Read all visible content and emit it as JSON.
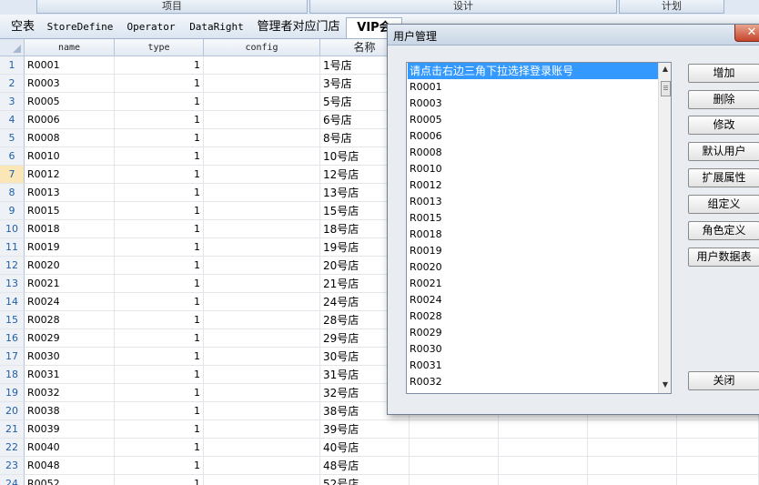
{
  "topbar": {
    "buttons": [
      "项目",
      "设计",
      "计划"
    ]
  },
  "tabs": [
    {
      "label": "空表",
      "active": false
    },
    {
      "label": "StoreDefine",
      "active": false
    },
    {
      "label": "Operator",
      "active": false
    },
    {
      "label": "DataRight",
      "active": false
    },
    {
      "label": "管理者对应门店",
      "active": false
    },
    {
      "label": "VIP会",
      "active": true
    }
  ],
  "grid": {
    "headers": [
      "name",
      "type",
      "config",
      "名称"
    ],
    "rows": [
      {
        "n": "1",
        "name": "R0001",
        "type": "1",
        "label": "1号店"
      },
      {
        "n": "2",
        "name": "R0003",
        "type": "1",
        "label": "3号店"
      },
      {
        "n": "3",
        "name": "R0005",
        "type": "1",
        "label": "5号店"
      },
      {
        "n": "4",
        "name": "R0006",
        "type": "1",
        "label": "6号店"
      },
      {
        "n": "5",
        "name": "R0008",
        "type": "1",
        "label": "8号店"
      },
      {
        "n": "6",
        "name": "R0010",
        "type": "1",
        "label": "10号店"
      },
      {
        "n": "7",
        "name": "R0012",
        "type": "1",
        "label": "12号店"
      },
      {
        "n": "8",
        "name": "R0013",
        "type": "1",
        "label": "13号店"
      },
      {
        "n": "9",
        "name": "R0015",
        "type": "1",
        "label": "15号店"
      },
      {
        "n": "10",
        "name": "R0018",
        "type": "1",
        "label": "18号店"
      },
      {
        "n": "11",
        "name": "R0019",
        "type": "1",
        "label": "19号店"
      },
      {
        "n": "12",
        "name": "R0020",
        "type": "1",
        "label": "20号店"
      },
      {
        "n": "13",
        "name": "R0021",
        "type": "1",
        "label": "21号店"
      },
      {
        "n": "14",
        "name": "R0024",
        "type": "1",
        "label": "24号店"
      },
      {
        "n": "15",
        "name": "R0028",
        "type": "1",
        "label": "28号店"
      },
      {
        "n": "16",
        "name": "R0029",
        "type": "1",
        "label": "29号店"
      },
      {
        "n": "17",
        "name": "R0030",
        "type": "1",
        "label": "30号店"
      },
      {
        "n": "18",
        "name": "R0031",
        "type": "1",
        "label": "31号店"
      },
      {
        "n": "19",
        "name": "R0032",
        "type": "1",
        "label": "32号店"
      },
      {
        "n": "20",
        "name": "R0038",
        "type": "1",
        "label": "38号店"
      },
      {
        "n": "21",
        "name": "R0039",
        "type": "1",
        "label": "39号店"
      },
      {
        "n": "22",
        "name": "R0040",
        "type": "1",
        "label": "40号店"
      },
      {
        "n": "23",
        "name": "R0048",
        "type": "1",
        "label": "48号店"
      },
      {
        "n": "24",
        "name": "R0052",
        "type": "1",
        "label": "52号店"
      }
    ],
    "highlighted_row": "7"
  },
  "dialog": {
    "title": "用户管理",
    "close_label": "✕",
    "list_items": [
      "请点击右边三角下拉选择登录账号",
      "R0001",
      "R0003",
      "R0005",
      "R0006",
      "R0008",
      "R0010",
      "R0012",
      "R0013",
      "R0015",
      "R0018",
      "R0019",
      "R0020",
      "R0021",
      "R0024",
      "R0028",
      "R0029",
      "R0030",
      "R0031",
      "R0032"
    ],
    "selected_index": 0,
    "buttons": {
      "add": "增加",
      "delete": "删除",
      "modify": "修改",
      "default_user": "默认用户",
      "ext_props": "扩展属性",
      "group_def": "组定义",
      "role_def": "角色定义",
      "user_data_table": "用户数据表",
      "close": "关闭"
    }
  },
  "colors": {
    "selection": "#3399ff",
    "row_number_text": "#1f5fa8",
    "close_button": "#c6442c"
  }
}
